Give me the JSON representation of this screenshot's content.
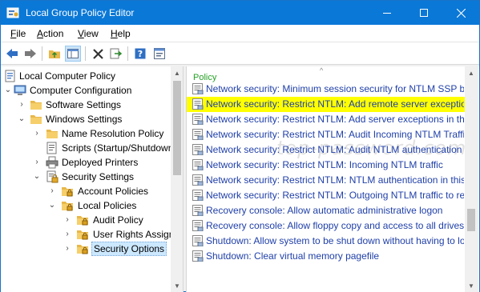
{
  "window": {
    "title": "Local Group Policy Editor",
    "accent": "#0a78d7"
  },
  "menu": {
    "items": [
      {
        "label": "File",
        "ul": "F",
        "rest": "ile"
      },
      {
        "label": "Action",
        "ul": "A",
        "rest": "ction"
      },
      {
        "label": "View",
        "ul": "V",
        "rest": "iew"
      },
      {
        "label": "Help",
        "ul": "H",
        "rest": "elp"
      }
    ]
  },
  "toolbar": {
    "icons": [
      "back-arrow-icon",
      "forward-arrow-icon",
      "up-folder-icon",
      "show-hide-tree-icon",
      "delete-icon",
      "export-list-icon",
      "help-icon",
      "properties-icon"
    ]
  },
  "tree": {
    "items": [
      {
        "label": "Local Computer Policy",
        "level": 0,
        "expander": "",
        "icon": "computer-policy-icon"
      },
      {
        "label": "Computer Configuration",
        "level": 1,
        "expander": "v",
        "icon": "computer-icon"
      },
      {
        "label": "Software Settings",
        "level": 2,
        "expander": ">",
        "icon": "folder-icon"
      },
      {
        "label": "Windows Settings",
        "level": 2,
        "expander": "v",
        "icon": "folder-icon"
      },
      {
        "label": "Name Resolution Policy",
        "level": 3,
        "expander": ">",
        "icon": "folder-icon"
      },
      {
        "label": "Scripts (Startup/Shutdown)",
        "level": 3,
        "expander": "",
        "icon": "script-icon"
      },
      {
        "label": "Deployed Printers",
        "level": 3,
        "expander": ">",
        "icon": "printer-icon"
      },
      {
        "label": "Security Settings",
        "level": 3,
        "expander": "v",
        "icon": "security-settings-icon"
      },
      {
        "label": "Account Policies",
        "level": 4,
        "expander": ">",
        "icon": "secure-folder-icon"
      },
      {
        "label": "Local Policies",
        "level": 4,
        "expander": "v",
        "icon": "secure-folder-icon"
      },
      {
        "label": "Audit Policy",
        "level": 5,
        "expander": ">",
        "icon": "secure-folder-icon"
      },
      {
        "label": "User Rights Assignment",
        "level": 5,
        "expander": ">",
        "icon": "secure-folder-icon"
      },
      {
        "label": "Security Options",
        "level": 5,
        "expander": ">",
        "icon": "secure-folder-icon",
        "selected": true
      }
    ]
  },
  "list": {
    "header": "Policy",
    "sort_indicator": "^",
    "items": [
      "Network security: Minimum session security for NTLM SSP based",
      "Network security: Restrict NTLM: Add remote server exceptions for",
      "Network security: Restrict NTLM: Add server exceptions in this dom",
      "Network security: Restrict NTLM: Audit Incoming NTLM Traffic",
      "Network security: Restrict NTLM: Audit NTLM authentication in thi",
      "Network security: Restrict NTLM: Incoming NTLM traffic",
      "Network security: Restrict NTLM: NTLM authentication in this dom",
      "Network security: Restrict NTLM: Outgoing NTLM traffic to remote",
      "Recovery console: Allow automatic administrative logon",
      "Recovery console: Allow floppy copy and access to all drives and",
      "Shutdown: Allow system to be shut down without having to log on",
      "Shutdown: Clear virtual memory pagefile"
    ],
    "highlighted_index": 1,
    "highlight_color": "#ffff00"
  },
  "watermark": "top-password.com"
}
